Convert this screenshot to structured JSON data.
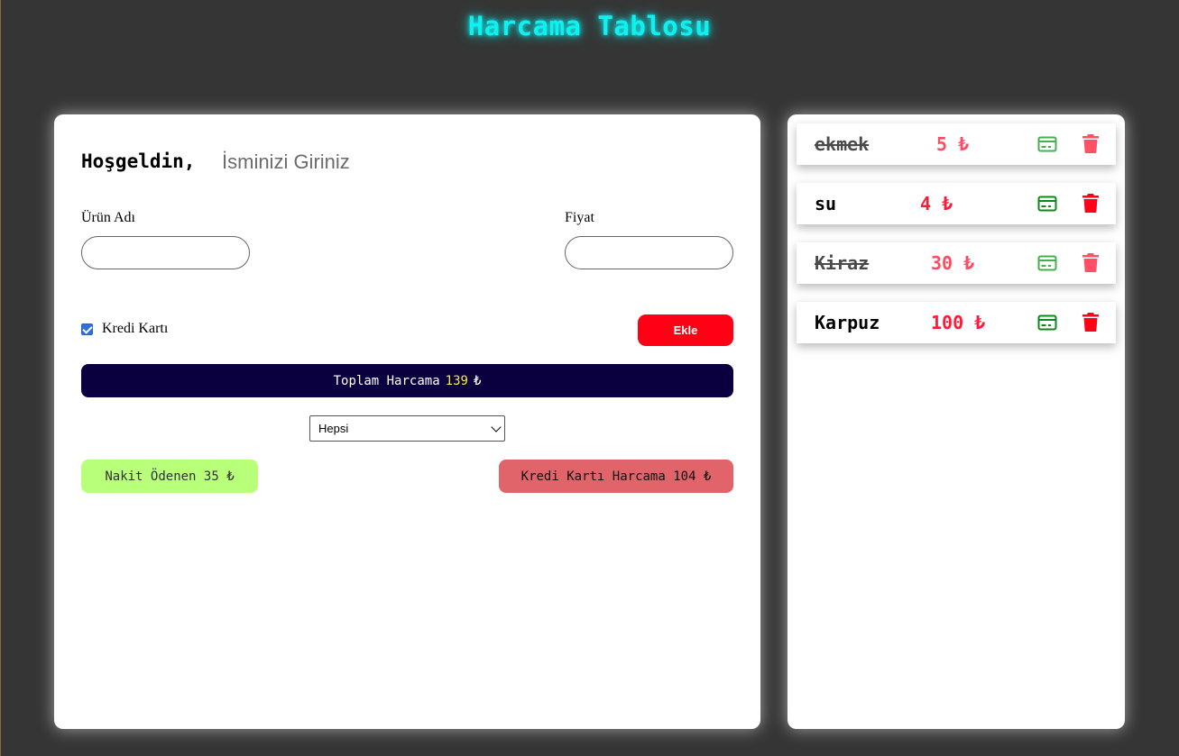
{
  "header": {
    "title": "Harcama Tablosu"
  },
  "form": {
    "welcome": "Hoşgeldin,",
    "name_placeholder": "İsminizi Giriniz",
    "product_label": "Ürün Adı",
    "price_label": "Fiyat",
    "credit_card_label": "Kredi Kartı",
    "credit_card_checked": true,
    "add_button": "Ekle"
  },
  "total": {
    "label": "Toplam Harcama",
    "amount": "139",
    "currency": "₺"
  },
  "filter": {
    "selected": "Hepsi"
  },
  "summary": {
    "cash": "Nakit Ödenen 35 ₺",
    "credit": "Kredi Kartı Harcama 104 ₺"
  },
  "items": [
    {
      "name": "ekmek",
      "price": "5 ₺",
      "done": true
    },
    {
      "name": "su",
      "price": "4 ₺",
      "done": false
    },
    {
      "name": "Kiraz",
      "price": "30 ₺",
      "done": true
    },
    {
      "name": "Karpuz",
      "price": "100 ₺",
      "done": false
    }
  ],
  "icons": {
    "card": "credit-card-icon",
    "delete": "trash-icon"
  },
  "colors": {
    "accent": "#11f0f0",
    "danger": "#ff0014",
    "total_bg": "#0a0040",
    "cash_bg": "#b8ff7a",
    "credit_bg": "#e0646a"
  }
}
